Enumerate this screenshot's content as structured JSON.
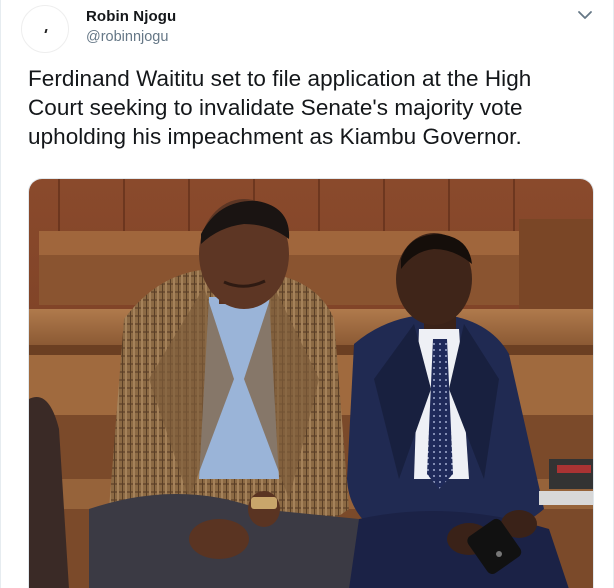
{
  "author": {
    "display_name": "Robin Njogu",
    "handle": "@robinnjogu"
  },
  "tweet": {
    "text": "Ferdinand Waititu set to file application at the High\nCourt seeking to invalidate Senate's majority vote\nupholding his impeachment as Kiambu Governor."
  },
  "icons": {
    "caret": "chevron-down-icon",
    "avatar": "avatar"
  },
  "colors": {
    "name": "#14171a",
    "handle": "#657786",
    "caret": "#657786",
    "border": "#e6ecf0"
  }
}
